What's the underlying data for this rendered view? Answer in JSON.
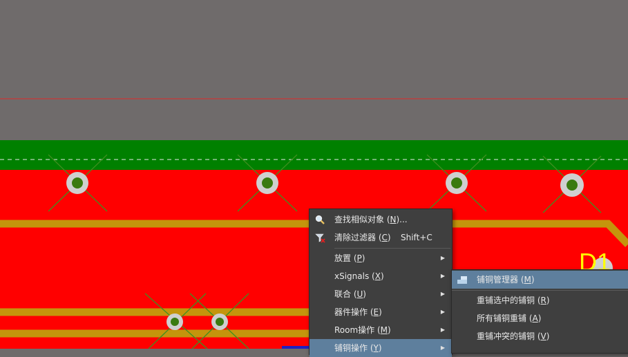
{
  "board": {
    "designator": "D1",
    "colors": {
      "background": "#6f6b6b",
      "top_layer_copper": "#ff0000",
      "keepout_band": "#008000",
      "trace": "#c4950c",
      "pad_ring": "#cfcfcf",
      "pad_center": "#3a7a10",
      "ratsnest": "#3f8f20",
      "guide_line": "#e02828",
      "designator": "#ffff00"
    }
  },
  "context_menu": {
    "items": [
      {
        "label": "查找相似对象 (",
        "key": "N",
        "suffix": ")...",
        "shortcut": "",
        "icon": "magnifier-icon",
        "submenu": false
      },
      {
        "label": "清除过滤器 (",
        "key": "C",
        "suffix": ")",
        "shortcut": "Shift+C",
        "icon": "clear-filter-icon",
        "submenu": false
      },
      {
        "label": "放置 (",
        "key": "P",
        "suffix": ")",
        "shortcut": "",
        "icon": "",
        "submenu": true
      },
      {
        "label": "xSignals (",
        "key": "X",
        "suffix": ")",
        "shortcut": "",
        "icon": "",
        "submenu": true
      },
      {
        "label": "联合 (",
        "key": "U",
        "suffix": ")",
        "shortcut": "",
        "icon": "",
        "submenu": true
      },
      {
        "label": "器件操作 (",
        "key": "E",
        "suffix": ")",
        "shortcut": "",
        "icon": "",
        "submenu": true
      },
      {
        "label": "Room操作 (",
        "key": "M",
        "suffix": ")",
        "shortcut": "",
        "icon": "",
        "submenu": true
      },
      {
        "label": "铺铜操作 (",
        "key": "Y",
        "suffix": ")",
        "shortcut": "",
        "icon": "",
        "submenu": true
      }
    ]
  },
  "polygon_submenu": {
    "items": [
      {
        "label": "铺铜管理器 (",
        "key": "M",
        "suffix": ")",
        "icon": "polygon-manager-icon"
      },
      {
        "label": "重铺选中的铺铜 (",
        "key": "R",
        "suffix": ")",
        "icon": ""
      },
      {
        "label": "所有铺铜重铺 (",
        "key": "A",
        "suffix": ")",
        "icon": ""
      },
      {
        "label": "重铺冲突的铺铜 (",
        "key": "V",
        "suffix": ")",
        "icon": ""
      }
    ]
  }
}
